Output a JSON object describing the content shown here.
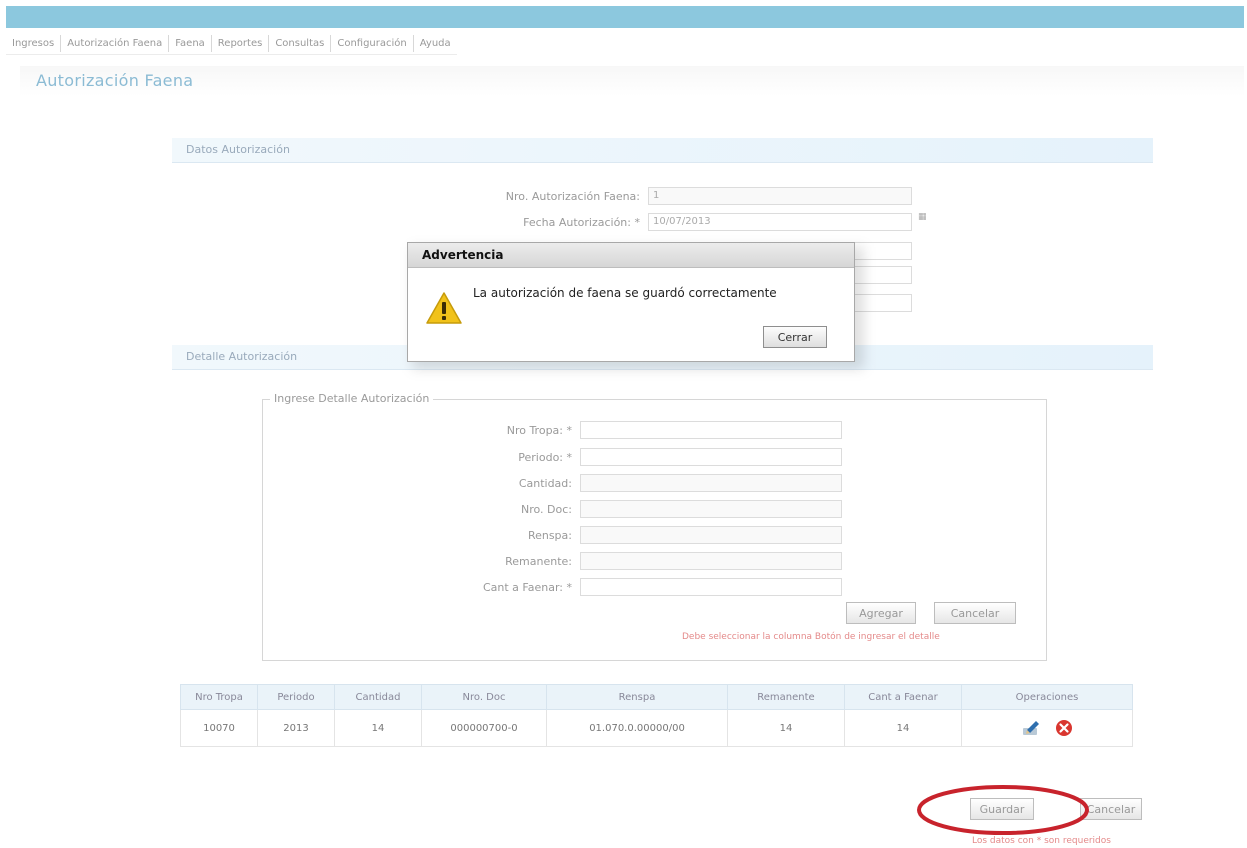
{
  "menu": [
    "Ingresos",
    "Autorización Faena",
    "Faena",
    "Reportes",
    "Consultas",
    "Configuración",
    "Ayuda"
  ],
  "page_title": "Autorización Faena",
  "section_datos": "Datos Autorización",
  "section_detalle": "Detalle Autorización",
  "form": {
    "nro_autorizacion_label": "Nro. Autorización Faena:",
    "nro_autorizacion_value": "1",
    "fecha_label": "Fecha Autorización: *",
    "fecha_value": "10/07/2013"
  },
  "detail_form": {
    "legend": "Ingrese Detalle Autorización",
    "nro_tropa_label": "Nro Tropa: *",
    "periodo_label": "Periodo: *",
    "cantidad_label": "Cantidad:",
    "nro_doc_label": "Nro. Doc:",
    "renspa_label": "Renspa:",
    "remanente_label": "Remanente:",
    "cant_faenar_label": "Cant a Faenar: *",
    "agregar_button": "Agregar",
    "cancelar_button": "Cancelar",
    "hint": "Debe seleccionar la columna Botón de ingresar el detalle"
  },
  "table": {
    "headers": [
      "Nro Tropa",
      "Periodo",
      "Cantidad",
      "Nro. Doc",
      "Renspa",
      "Remanente",
      "Cant a Faenar",
      "Operaciones"
    ],
    "rows": [
      [
        "10070",
        "2013",
        "14",
        "000000700-0",
        "01.070.0.00000/00",
        "14",
        "14"
      ]
    ]
  },
  "footer": {
    "guardar_button": "Guardar",
    "cancelar_button": "Cancelar",
    "required_note": "Los datos con * son requeridos"
  },
  "modal": {
    "title": "Advertencia",
    "message": "La autorización de faena se guardó correctamente",
    "button": "Cerrar"
  },
  "colors": {
    "topbar": "#8cc8de",
    "highlight_ellipse": "#c8232c",
    "delete_icon": "#d9362f"
  }
}
